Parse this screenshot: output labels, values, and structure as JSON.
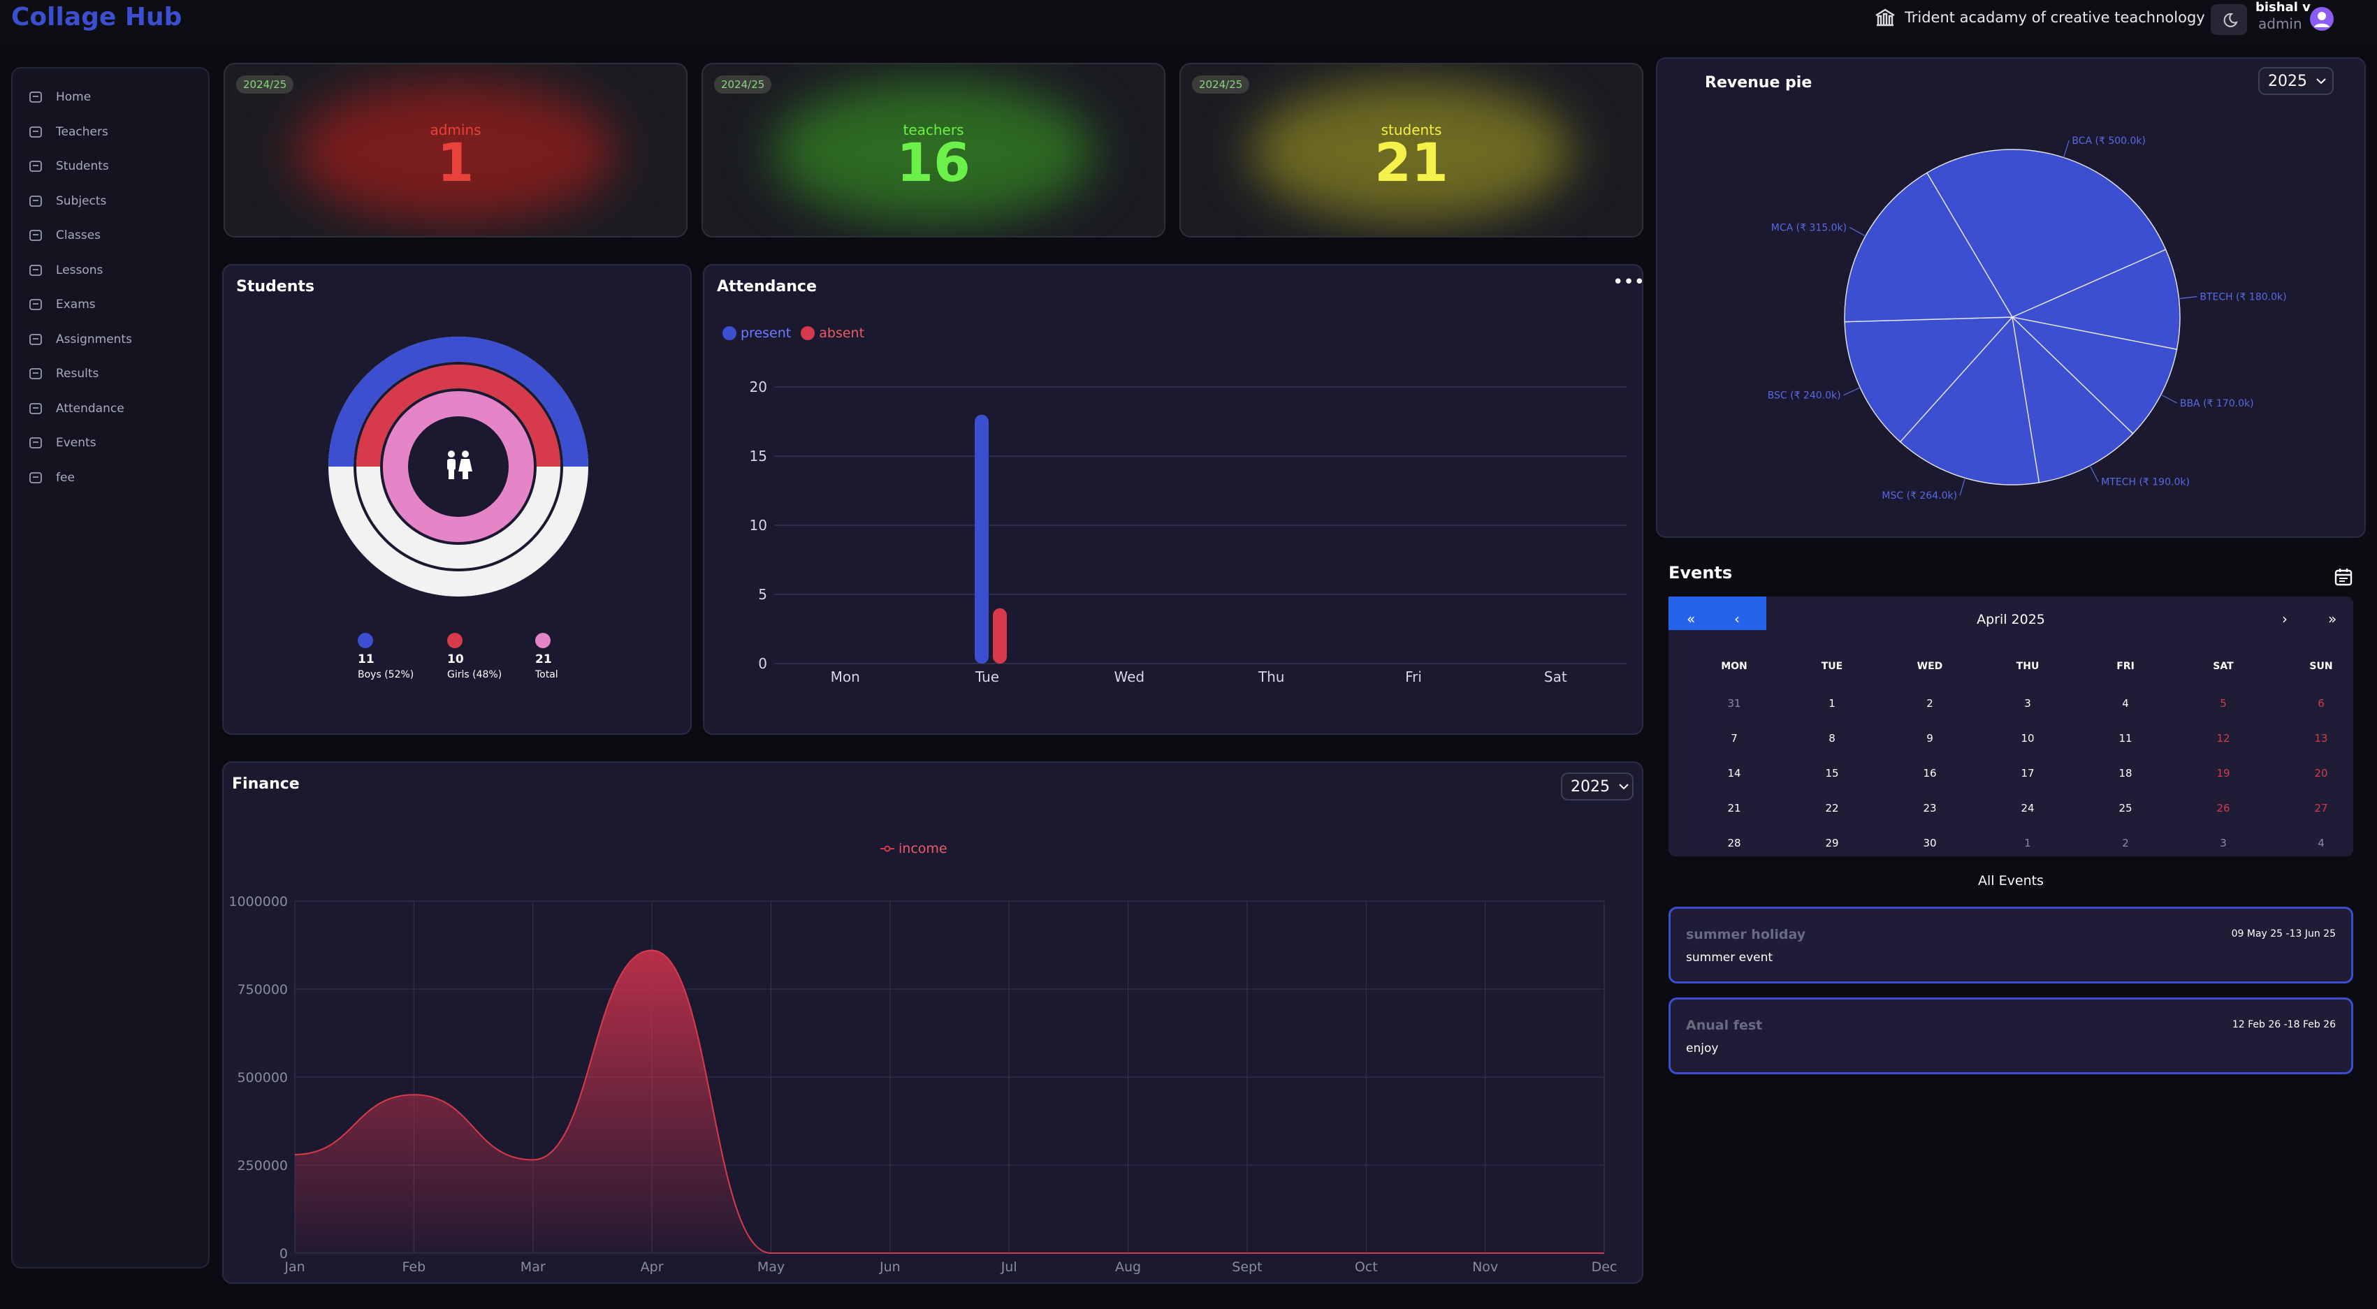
{
  "header": {
    "brand": "Collage Hub",
    "school": "Trident acadamy of creative teachnology",
    "user_name": "bishal v",
    "user_role": "admin"
  },
  "sidebar": {
    "items": [
      {
        "label": "Home",
        "icon": "home-icon"
      },
      {
        "label": "Teachers",
        "icon": "teacher-icon"
      },
      {
        "label": "Students",
        "icon": "student-icon"
      },
      {
        "label": "Subjects",
        "icon": "book-icon"
      },
      {
        "label": "Classes",
        "icon": "class-icon"
      },
      {
        "label": "Lessons",
        "icon": "lesson-icon"
      },
      {
        "label": "Exams",
        "icon": "exam-icon"
      },
      {
        "label": "Assignments",
        "icon": "assignment-icon"
      },
      {
        "label": "Results",
        "icon": "results-icon"
      },
      {
        "label": "Attendance",
        "icon": "attendance-icon"
      },
      {
        "label": "Events",
        "icon": "calendar-icon"
      },
      {
        "label": "fee",
        "icon": "fee-icon"
      }
    ]
  },
  "stats": [
    {
      "year": "2024/25",
      "label": "admins",
      "value": "1",
      "color": "#e8423d",
      "glow": "#7a1d1d"
    },
    {
      "year": "2024/25",
      "label": "teachers",
      "value": "16",
      "color": "#6cf04a",
      "glow": "#2d6a22"
    },
    {
      "year": "2024/25",
      "label": "students",
      "value": "21",
      "color": "#f5f04a",
      "glow": "#6d6a22"
    }
  ],
  "students_card": {
    "title": "Students",
    "legend": [
      {
        "value": "11",
        "label": "Boys (52%)",
        "color": "#3b4fd0"
      },
      {
        "value": "10",
        "label": "Girls (48%)",
        "color": "#d63a4b"
      },
      {
        "value": "21",
        "label": "Total",
        "color": "#e584c7"
      }
    ]
  },
  "attendance": {
    "title": "Attendance",
    "legend_present": "present",
    "legend_absent": "absent"
  },
  "revenue": {
    "title": "Revenue pie",
    "year": "2025"
  },
  "finance": {
    "title": "Finance",
    "year": "2025",
    "legend": "income"
  },
  "events": {
    "title": "Events",
    "month": "April 2025",
    "all_events": "All Events",
    "list": [
      {
        "name": "summer holiday",
        "date": "09 May 25 -13 Jun 25",
        "desc": "summer event"
      },
      {
        "name": "Anual fest",
        "date": "12 Feb 26 -18 Feb 26",
        "desc": "enjoy"
      }
    ]
  },
  "calendar": {
    "weekdays": [
      "MON",
      "TUE",
      "WED",
      "THU",
      "FRI",
      "SAT",
      "SUN"
    ],
    "weeks": [
      [
        "31",
        "1",
        "2",
        "3",
        "4",
        "5",
        "6"
      ],
      [
        "7",
        "8",
        "9",
        "10",
        "11",
        "12",
        "13"
      ],
      [
        "14",
        "15",
        "16",
        "17",
        "18",
        "19",
        "20"
      ],
      [
        "21",
        "22",
        "23",
        "24",
        "25",
        "26",
        "27"
      ],
      [
        "28",
        "29",
        "30",
        "1",
        "2",
        "3",
        "4"
      ]
    ],
    "selected": "30"
  },
  "chart_data": [
    {
      "type": "pie",
      "title": "Revenue pie",
      "categories": [
        "BCA",
        "BTECH",
        "BBA",
        "MTECH",
        "MSC",
        "BSC",
        "MCA"
      ],
      "labels": [
        "BCA (₹ 500.0k)",
        "BTECH (₹ 180.0k)",
        "BBA (₹ 170.0k)",
        "MTECH (₹ 190.0k)",
        "MSC (₹ 264.0k)",
        "BSC (₹ 240.0k)",
        "MCA (₹ 315.0k)"
      ],
      "values": [
        500,
        180,
        170,
        190,
        264,
        240,
        315
      ],
      "color": "#3b4fd0"
    },
    {
      "type": "bar",
      "title": "Attendance",
      "categories": [
        "Mon",
        "Tue",
        "Wed",
        "Thu",
        "Fri",
        "Sat"
      ],
      "series": [
        {
          "name": "present",
          "values": [
            0,
            18,
            0,
            0,
            0,
            0
          ],
          "color": "#3b4fd0"
        },
        {
          "name": "absent",
          "values": [
            0,
            4,
            0,
            0,
            0,
            0
          ],
          "color": "#d63a4b"
        }
      ],
      "ylim": [
        0,
        20
      ],
      "yticks": [
        "0",
        "5",
        "10",
        "15",
        "20"
      ]
    },
    {
      "type": "area",
      "title": "Finance",
      "categories": [
        "Jan",
        "Feb",
        "Mar",
        "Apr",
        "May",
        "Jun",
        "Jul",
        "Aug",
        "Sept",
        "Oct",
        "Nov",
        "Dec"
      ],
      "series": [
        {
          "name": "income",
          "values": [
            280000,
            450000,
            265000,
            860000,
            0,
            0,
            0,
            0,
            0,
            0,
            0,
            0
          ],
          "color": "#d63a4b"
        }
      ],
      "ylim": [
        0,
        1000000
      ],
      "yticks": [
        "0",
        "250000",
        "500000",
        "750000",
        "1000000"
      ]
    },
    {
      "type": "pie",
      "title": "Students",
      "categories": [
        "Boys",
        "Girls",
        "Total"
      ],
      "values": [
        11,
        10,
        21
      ]
    }
  ]
}
